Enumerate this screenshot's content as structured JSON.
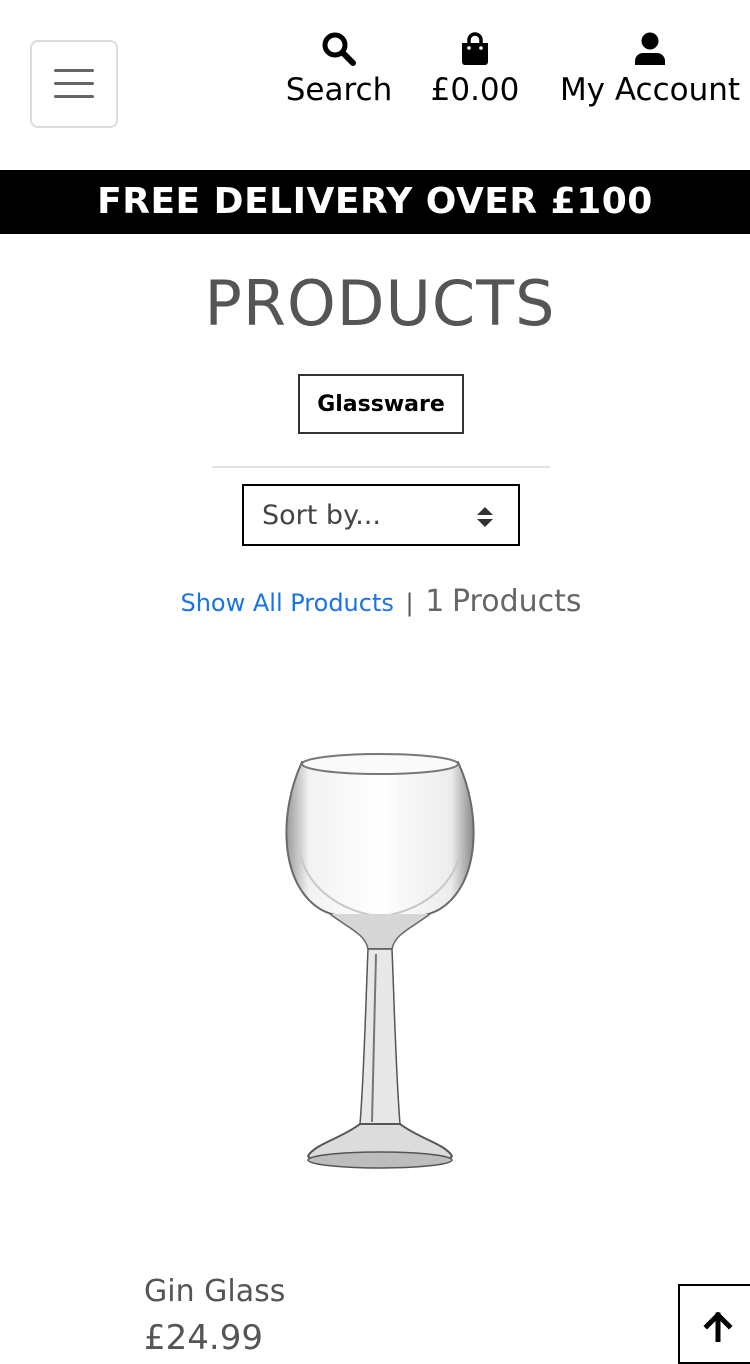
{
  "header": {
    "menu_icon": "hamburger-icon",
    "search": {
      "icon": "search-icon",
      "label": "Search"
    },
    "bag": {
      "icon": "shopping-bag-icon",
      "label": "£0.00"
    },
    "account": {
      "icon": "user-icon",
      "label": "My Account"
    }
  },
  "banner": {
    "text": "FREE DELIVERY OVER £100"
  },
  "main": {
    "title": "PRODUCTS",
    "category_badge": "Glassware",
    "sort": {
      "selected": "Sort by...",
      "icon": "sort-arrows-icon"
    },
    "results": {
      "show_all_label": "Show All Products",
      "separator": "|",
      "count": "1",
      "count_label": "Products"
    }
  },
  "products": [
    {
      "name": "Gin Glass",
      "price": "£24.99",
      "image": "gin-glass-image"
    }
  ],
  "back_to_top": {
    "icon": "arrow-up-icon"
  },
  "colors": {
    "link": "#1a73e8",
    "banner_bg": "#000000",
    "text": "#555555"
  }
}
